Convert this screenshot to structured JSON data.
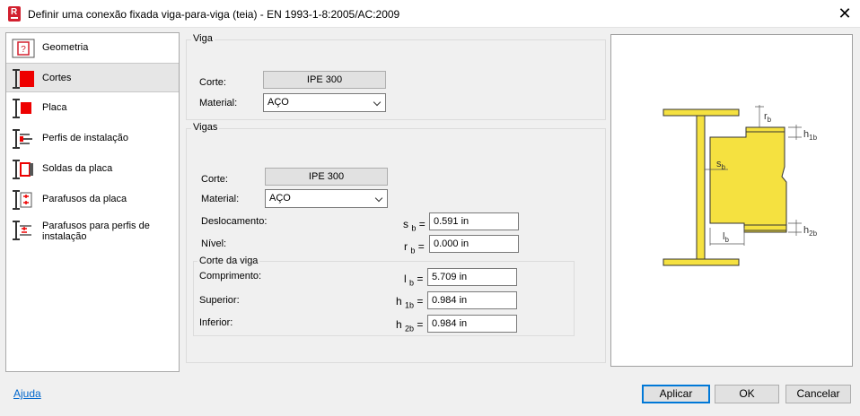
{
  "window": {
    "title": "Definir uma conexão fixada viga-para-viga (teia) - EN 1993-1-8:2005/AC:2009",
    "app_letter": "R",
    "close_glyph": "✕"
  },
  "nav": {
    "items": [
      {
        "label": "Geometria",
        "icon": "geometry-icon"
      },
      {
        "label": "Cortes",
        "icon": "cuts-icon",
        "selected": true
      },
      {
        "label": "Placa",
        "icon": "plate-icon"
      },
      {
        "label": "Perfis de instalação",
        "icon": "installation-profiles-icon"
      },
      {
        "label": "Soldas da placa",
        "icon": "plate-welds-icon"
      },
      {
        "label": "Parafusos da placa",
        "icon": "plate-bolts-icon"
      },
      {
        "label": "Parafusos para perfis de instalação",
        "icon": "profile-bolts-icon"
      }
    ]
  },
  "viga": {
    "title": "Viga",
    "corte_label": "Corte:",
    "corte_value": "IPE 300",
    "material_label": "Material:",
    "material_value": "AÇO"
  },
  "vigas": {
    "title": "Vigas",
    "corte_label": "Corte:",
    "corte_value": "IPE 300",
    "material_label": "Material:",
    "material_value": "AÇO",
    "deslocamento_label": "Deslocamento:",
    "deslocamento_sym": "s",
    "deslocamento_sub": "b",
    "deslocamento_value": "0.591 in",
    "nivel_label": "Nível:",
    "nivel_sym": "r",
    "nivel_sub": "b",
    "nivel_value": "0.000 in"
  },
  "corte_viga": {
    "title": "Corte da viga",
    "comprimento_label": "Comprimento:",
    "comprimento_sym": "l",
    "comprimento_sub": "b",
    "comprimento_value": "5.709 in",
    "superior_label": "Superior:",
    "superior_sym": "h",
    "superior_sub": "1b",
    "superior_value": "0.984 in",
    "inferior_label": "Inferior:",
    "inferior_sym": "h",
    "inferior_sub": "2b",
    "inferior_value": "0.984 in",
    "equals": "="
  },
  "diagram": {
    "label_rb": "r",
    "label_rb_sub": "b",
    "label_h1b": "h",
    "label_h1b_sub": "1b",
    "label_sb": "s",
    "label_sb_sub": "b",
    "label_h2b": "h",
    "label_h2b_sub": "2b",
    "label_lb": "l",
    "label_lb_sub": "b",
    "fill_color": "#f5e140",
    "stroke_color": "#333333"
  },
  "footer": {
    "help": "Ajuda",
    "apply": "Aplicar",
    "ok": "OK",
    "cancel": "Cancelar"
  }
}
